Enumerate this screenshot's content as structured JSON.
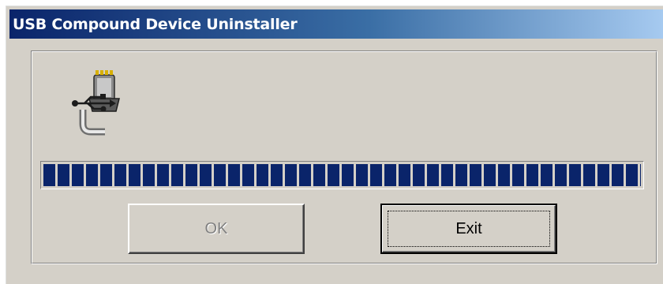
{
  "window": {
    "title": "USB Compound Device Uninstaller"
  },
  "icon": {
    "name": "usb-plug-icon"
  },
  "progress": {
    "percent": 100,
    "color": "#0a246a"
  },
  "buttons": {
    "ok_label": "OK",
    "ok_enabled": false,
    "exit_label": "Exit",
    "exit_default": true
  },
  "colors": {
    "title_start": "#0a246a",
    "title_end": "#a6caf0",
    "face": "#d4d0c8"
  }
}
